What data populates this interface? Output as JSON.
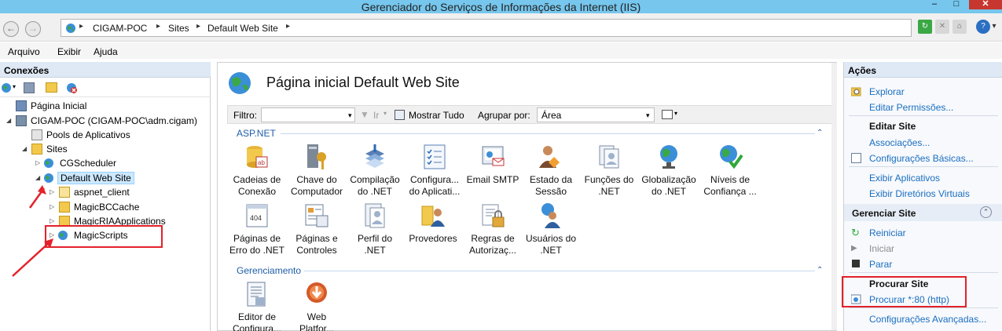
{
  "window": {
    "title": "Gerenciador do Serviços de Informações da Internet (IIS)"
  },
  "address": {
    "crumbs": [
      "CIGAM-POC",
      "Sites",
      "Default Web Site"
    ]
  },
  "menu": {
    "items": [
      "Arquivo",
      "Exibir",
      "Ajuda"
    ]
  },
  "connections": {
    "header": "Conexões",
    "tree": [
      {
        "label": "Página Inicial"
      },
      {
        "label": "CIGAM-POC (CIGAM-POC\\adm.cigam)"
      },
      {
        "label": "Pools de Aplicativos"
      },
      {
        "label": "Sites"
      },
      {
        "label": "CGScheduler"
      },
      {
        "label": "Default Web Site"
      },
      {
        "label": "aspnet_client"
      },
      {
        "label": "MagicBCCache"
      },
      {
        "label": "MagicRIAApplications"
      },
      {
        "label": "MagicScripts"
      }
    ]
  },
  "main": {
    "title": "Página inicial Default Web Site",
    "filter": {
      "label": "Filtro:",
      "go": "Ir",
      "show_all": "Mostrar Tudo",
      "group_label": "Agrupar por:",
      "group_value": "Área"
    },
    "sections": [
      {
        "name": "ASP.NET",
        "features": [
          [
            "Cadeias de",
            "Conexão"
          ],
          [
            "Chave do",
            "Computador"
          ],
          [
            "Compilação",
            "do .NET"
          ],
          [
            "Configura...",
            "do Aplicati..."
          ],
          [
            "Email SMTP",
            ""
          ],
          [
            "Estado da",
            "Sessão"
          ],
          [
            "Funções do",
            ".NET"
          ],
          [
            "Globalização",
            "do .NET"
          ],
          [
            "Níveis de",
            "Confiança ..."
          ],
          [
            "Páginas de",
            "Erro do .NET"
          ],
          [
            "Páginas e",
            "Controles"
          ],
          [
            "Perfil do",
            ".NET"
          ],
          [
            "Provedores",
            ""
          ],
          [
            "Regras de",
            "Autorizaç..."
          ],
          [
            "Usuários do",
            ".NET"
          ]
        ]
      },
      {
        "name": "Gerenciamento",
        "features": [
          [
            "Editor de",
            "Configura..."
          ],
          [
            "Web",
            "Platfor..."
          ]
        ]
      }
    ]
  },
  "actions": {
    "header": "Ações",
    "explorar": "Explorar",
    "editar_permissoes": "Editar Permissões...",
    "editar_site": "Editar Site",
    "associacoes": "Associações...",
    "config_basicas": "Configurações Básicas...",
    "exibir_aplicativos": "Exibir Aplicativos",
    "exibir_diretorios": "Exibir Diretórios Virtuais",
    "gerenciar_site": "Gerenciar Site",
    "reiniciar": "Reiniciar",
    "iniciar": "Iniciar",
    "parar": "Parar",
    "procurar_site": "Procurar Site",
    "procurar_80": "Procurar *:80 (http)",
    "config_avancadas": "Configurações Avançadas..."
  },
  "colors": {
    "titlebar": "#76c6ed",
    "link": "#1a6ec0",
    "highlight_red": "#e3212a",
    "selection": "#cce8ff"
  }
}
